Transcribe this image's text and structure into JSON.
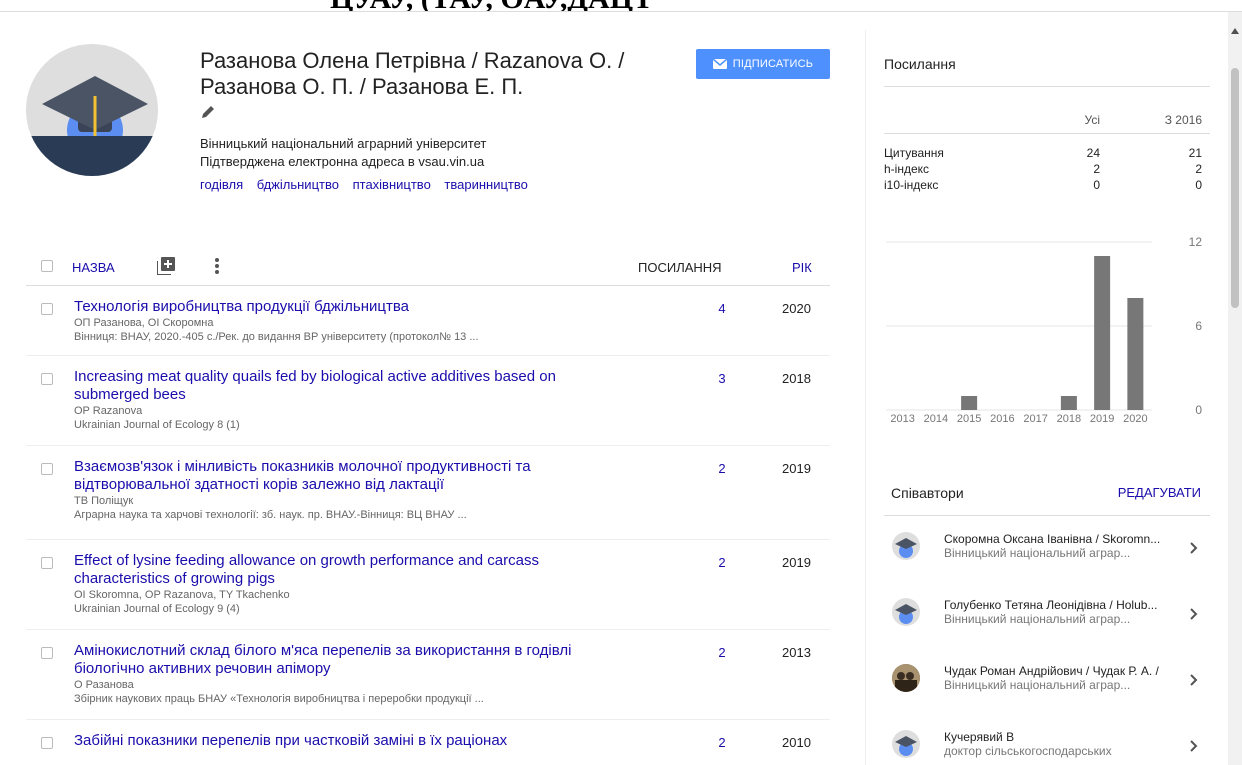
{
  "topbar": {
    "text": "ЦУАУ, (ТАУ, OАУ,ДАЦТ"
  },
  "profile": {
    "name": "Разанова Олена Петрівна / Razanova О. / Разанова О. П. / Разанова Е. П.",
    "affiliation": "Вінницький національний аграрний університет",
    "email": "Підтверджена електронна адреса в vsau.vin.ua",
    "keywords": [
      "годівля",
      "бджільництво",
      "птахівництво",
      "тваринництво"
    ],
    "follow_label": "ПІДПИСАТИСЬ"
  },
  "table": {
    "col_title": "НАЗВА",
    "col_cites": "ПОСИЛАННЯ",
    "col_year": "РІК",
    "rows": [
      {
        "title": "Технологія виробництва продукції бджільництва",
        "authors": "ОП Разанова, ОІ Скоромна",
        "venue": "Вінниця: ВНАУ, 2020.-405 с./Рек. до видання ВР університету (протокол№ 13 ...",
        "cites": "4",
        "year": "2020"
      },
      {
        "title": "Increasing meat quality quails fed by biological active additives based on submerged bees",
        "authors": "OP Razanova",
        "venue": "Ukrainian Journal of Ecology 8 (1)",
        "cites": "3",
        "year": "2018"
      },
      {
        "title": "Взаємозв'язок і мінливість показників молочної продуктивності та відтворювальної здатності корів залежно від лактації",
        "authors": "ТВ Поліщук",
        "venue": "Аграрна наука та харчові технології: зб. наук. пр. ВНАУ.-Вінниця: ВЦ ВНАУ ...",
        "cites": "2",
        "year": "2019"
      },
      {
        "title": "Effect of lysine feeding allowance on growth performance and carcass characteristics of growing pigs",
        "authors": "OI Skoromna, OP Razanova, TY Tkachenko",
        "venue": "Ukrainian Journal of Ecology 9 (4)",
        "cites": "2",
        "year": "2019"
      },
      {
        "title": "Амінокислотний склад білого м'яса перепелів за використання в годівлі біологічно активних речовин апімору",
        "authors": "О Разанова",
        "venue": "Збірник наукових праць БНАУ «Технологія виробництва і переробки продукції ...",
        "cites": "2",
        "year": "2013"
      },
      {
        "title": "Забійні показники перепелів при частковій заміні в їх раціонах",
        "authors": "",
        "venue": "",
        "cites": "2",
        "year": "2010"
      }
    ]
  },
  "metrics": {
    "heading": "Посилання",
    "col_all": "Усі",
    "col_since": "З 2016",
    "rows": [
      {
        "label": "Цитування",
        "all": "24",
        "since": "21"
      },
      {
        "label": "h-індекс",
        "all": "2",
        "since": "2"
      },
      {
        "label": "i10-індекс",
        "all": "0",
        "since": "0"
      }
    ]
  },
  "chart_data": {
    "type": "bar",
    "categories": [
      "2013",
      "2014",
      "2015",
      "2016",
      "2017",
      "2018",
      "2019",
      "2020"
    ],
    "values": [
      0,
      0,
      1,
      0,
      0,
      1,
      11,
      8
    ],
    "ylim": [
      0,
      12
    ],
    "yticks": [
      "0",
      "6",
      "12"
    ],
    "title": "",
    "xlabel": "",
    "ylabel": "",
    "bar_color": "#777777"
  },
  "coauthors": {
    "heading": "Співавтори",
    "edit_label": "РЕДАГУВАТИ",
    "items": [
      {
        "name": "Скоромна Оксана Іванівна / Skoromn...",
        "affiliation": "Вінницький національний аграр..."
      },
      {
        "name": "Голубенко Тетяна Леонідівна / Holub...",
        "affiliation": "Вінницький національний аграр..."
      },
      {
        "name": "Чудак Роман Андрійович / Чудак Р. А. /",
        "affiliation": "Вінницький національний аграр..."
      },
      {
        "name": "Кучерявий В",
        "affiliation": "доктор сільськогосподарських"
      }
    ]
  },
  "colors": {
    "link": "#1a0dab",
    "follow_button": "#4d90fe",
    "avatar_band": "#2a3b56"
  },
  "icons": [
    "graduation-cap-icon",
    "add-photo-icon",
    "edit-pencil-icon",
    "mail-icon",
    "add-box-icon",
    "more-vert-icon",
    "chevron-right-icon"
  ]
}
